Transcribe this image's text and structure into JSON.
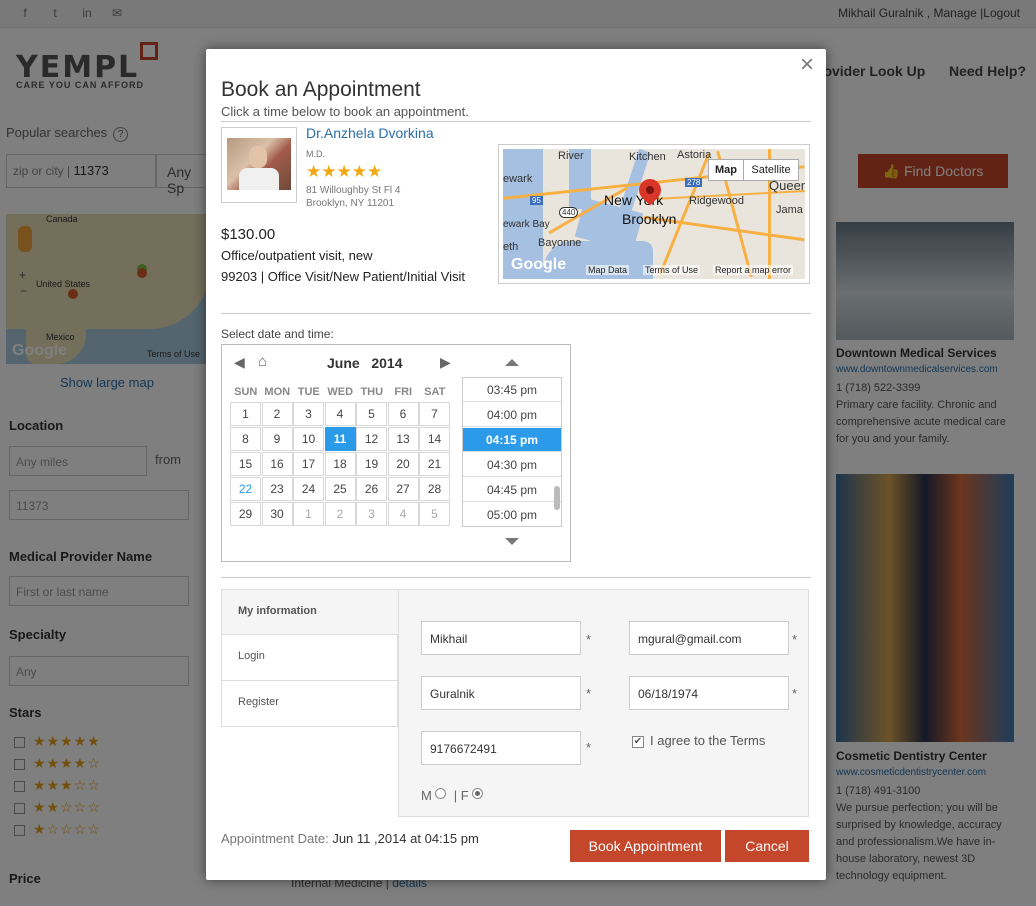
{
  "background": {
    "social_icons": [
      "f",
      "t",
      "in",
      "✉"
    ],
    "user": {
      "name": "Mikhail Guralnik",
      "manage": "Manage",
      "logout": "Logout"
    },
    "logo": {
      "text": "YEMPL",
      "tagline": "CARE YOU CAN AFFORD"
    },
    "nav": [
      "rovider Look Up",
      "Need Help?"
    ],
    "popular_searches": "Popular searches",
    "zip_placeholder": "zip or city |",
    "zip_value": "11373",
    "specialty_partial": "Any Sp",
    "find_doctors": "Find Doctors",
    "minimap_labels": {
      "canada": "Canada",
      "us": "United States",
      "mexico": "Mexico",
      "terms": "Terms of Use",
      "google": "Google"
    },
    "show_large_map": "Show large map",
    "sidebar": {
      "location": "Location",
      "miles": "Any miles",
      "from": "from",
      "zip": "11373",
      "provider_name": "Medical Provider Name",
      "provider_placeholder": "First or last name",
      "specialty": "Specialty",
      "specialty_value": "Any",
      "stars": "Stars",
      "price": "Price"
    },
    "star_rows": [
      "★★★★★",
      "★★★★☆",
      "★★★☆☆",
      "★★☆☆☆",
      "★☆☆☆☆"
    ],
    "cards": [
      {
        "title": "Downtown Medical Services",
        "url": "www.downtownmedicalservices.com",
        "phone": "1 (718) 522-3399",
        "text": "Primary care facility. Chronic and comprehensive acute medical care for you and your family."
      },
      {
        "title": "Cosmetic Dentistry Center",
        "url": "www.cosmeticdentistrycenter.com",
        "phone": "1 (718) 491-3100",
        "text": "We pursue perfection; you will be surprised by knowledge, accuracy and professionalism.We have in-house laboratory, newest 3D technology equipment."
      }
    ],
    "bottom_partial": "Internal Medicine",
    "details": "details"
  },
  "modal": {
    "close": "×",
    "title": "Book an Appointment",
    "subtitle": "Click a time below to book an appointment.",
    "doctor": {
      "name": "Dr.Anzhela Dvorkina",
      "degree": "M.D.",
      "stars": "★★★★★",
      "address1": "81 Willoughby St Fl 4",
      "address2": "Brooklyn, NY 11201"
    },
    "price": "$130.00",
    "visit_type": "Office/outpatient visit, new",
    "visit_code": "99203 | Office Visit/New Patient/Initial Visit",
    "map": {
      "btn_map": "Map",
      "btn_satellite": "Satellite",
      "labels": [
        "River",
        "Kitchen",
        "Astoria",
        "ewark",
        "New York",
        "Brooklyn",
        "Ridgewood",
        "Queen",
        "Jama",
        "Bayonne",
        "ewark Bay",
        "eth"
      ],
      "shields": [
        "95",
        "440",
        "278"
      ],
      "google": "Google",
      "footer": [
        "Map Data",
        "Terms of Use",
        "Report a map error"
      ]
    },
    "select_label": "Select date and time:",
    "calendar": {
      "month": "June",
      "year": "2014",
      "day_headers": [
        "SUN",
        "MON",
        "TUE",
        "WED",
        "THU",
        "FRI",
        "SAT"
      ],
      "weeks": [
        [
          "1",
          "2",
          "3",
          "4",
          "5",
          "6",
          "7"
        ],
        [
          "8",
          "9",
          "10",
          "11",
          "12",
          "13",
          "14"
        ],
        [
          "15",
          "16",
          "17",
          "18",
          "19",
          "20",
          "21"
        ],
        [
          "22",
          "23",
          "24",
          "25",
          "26",
          "27",
          "28"
        ],
        [
          "29",
          "30",
          "1",
          "2",
          "3",
          "4",
          "5"
        ]
      ],
      "selected_day": "11",
      "today_day": "22"
    },
    "times": [
      "03:45 pm",
      "04:00 pm",
      "04:15 pm",
      "04:30 pm",
      "04:45 pm",
      "05:00 pm"
    ],
    "selected_time": "04:15 pm",
    "tabs": [
      "My information",
      "Login",
      "Register"
    ],
    "form": {
      "first_name": "Mikhail",
      "last_name": "Guralnik",
      "phone": "9176672491",
      "email": "mgural@gmail.com",
      "dob": "06/18/1974",
      "required_mark": "*",
      "agree": "I agree to the Terms",
      "gender_m": "M",
      "gender_sep": "| F"
    },
    "appointment_label": "Appointment Date:",
    "appointment_value": "Jun 11 ,2014 at 04:15 pm",
    "book_btn": "Book Appointment",
    "cancel_btn": "Cancel"
  },
  "colors": {
    "accent": "#c4472b",
    "selected": "#2b9be9",
    "link": "#2a6ea9",
    "star": "#f0a914"
  }
}
